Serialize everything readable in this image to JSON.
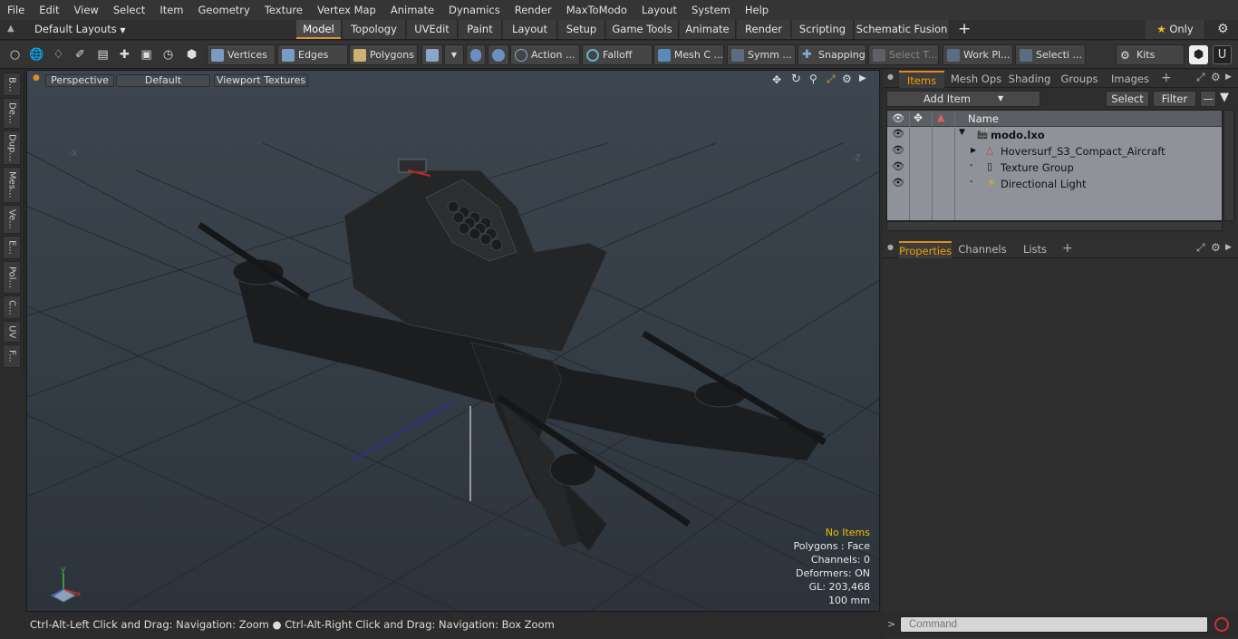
{
  "menu": [
    "File",
    "Edit",
    "View",
    "Select",
    "Item",
    "Geometry",
    "Texture",
    "Vertex Map",
    "Animate",
    "Dynamics",
    "Render",
    "MaxToModo",
    "Layout",
    "System",
    "Help"
  ],
  "layouts": {
    "label": "Default Layouts"
  },
  "layout_tabs": [
    "Model",
    "Topology",
    "UVEdit",
    "Paint",
    "Layout",
    "Setup",
    "Game Tools",
    "Animate",
    "Render",
    "Scripting",
    "Schematic Fusion"
  ],
  "only_label": "Only",
  "toolbar": {
    "vertices": "Vertices",
    "edges": "Edges",
    "polygons": "Polygons",
    "action": "Action ...",
    "falloff": "Falloff",
    "meshc": "Mesh C ...",
    "symm": "Symm ...",
    "snapping": "Snapping",
    "selectt": "Select T...",
    "workpl": "Work Pl...",
    "selecti": "Selecti ...",
    "kits": "Kits"
  },
  "left_tabs": [
    "B...",
    "De...",
    "Dup...",
    "Mes...",
    "Ve...",
    "E...",
    "Pol...",
    "C...",
    "UV",
    "F..."
  ],
  "viewport": {
    "perspective": "Perspective",
    "default": "Default",
    "textures": "Viewport Textures",
    "axis_x": "X",
    "axis_z": "Z",
    "stats": {
      "no_items": "No Items",
      "polygons": "Polygons : Face",
      "channels": "Channels: 0",
      "deformers": "Deformers: ON",
      "gl": "GL: 203,468",
      "scale": "100 mm"
    }
  },
  "status": "Ctrl-Alt-Left Click and Drag: Navigation: Zoom ● Ctrl-Alt-Right Click and Drag: Navigation: Box Zoom",
  "items_tabs": [
    "Items",
    "Mesh Ops",
    "Shading",
    "Groups",
    "Images"
  ],
  "items_toolbar": {
    "add_item": "Add Item",
    "select": "Select",
    "filter": "Filter"
  },
  "items_header": {
    "name": "Name"
  },
  "items": [
    {
      "label": "modo.lxo",
      "bold": true
    },
    {
      "label": "Hoversurf_S3_Compact_Aircraft"
    },
    {
      "label": "Texture Group"
    },
    {
      "label": "Directional Light"
    }
  ],
  "props_tabs": [
    "Properties",
    "Channels",
    "Lists"
  ],
  "command": {
    "placeholder": "Command"
  },
  "colors": {
    "accent": "#e0902a",
    "active_text": "#f0a000",
    "stats_warn": "#f0c000"
  }
}
